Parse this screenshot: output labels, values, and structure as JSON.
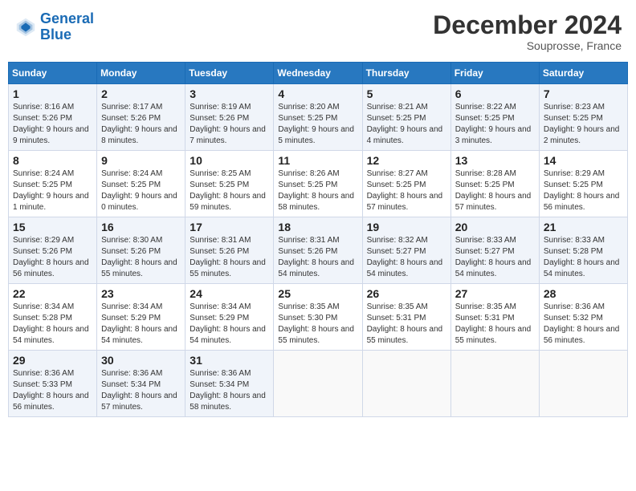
{
  "header": {
    "logo_line1": "General",
    "logo_line2": "Blue",
    "month": "December 2024",
    "location": "Souprosse, France"
  },
  "weekdays": [
    "Sunday",
    "Monday",
    "Tuesday",
    "Wednesday",
    "Thursday",
    "Friday",
    "Saturday"
  ],
  "weeks": [
    [
      {
        "day": "1",
        "sunrise": "8:16 AM",
        "sunset": "5:26 PM",
        "daylight": "9 hours and 9 minutes."
      },
      {
        "day": "2",
        "sunrise": "8:17 AM",
        "sunset": "5:26 PM",
        "daylight": "9 hours and 8 minutes."
      },
      {
        "day": "3",
        "sunrise": "8:19 AM",
        "sunset": "5:26 PM",
        "daylight": "9 hours and 7 minutes."
      },
      {
        "day": "4",
        "sunrise": "8:20 AM",
        "sunset": "5:25 PM",
        "daylight": "9 hours and 5 minutes."
      },
      {
        "day": "5",
        "sunrise": "8:21 AM",
        "sunset": "5:25 PM",
        "daylight": "9 hours and 4 minutes."
      },
      {
        "day": "6",
        "sunrise": "8:22 AM",
        "sunset": "5:25 PM",
        "daylight": "9 hours and 3 minutes."
      },
      {
        "day": "7",
        "sunrise": "8:23 AM",
        "sunset": "5:25 PM",
        "daylight": "9 hours and 2 minutes."
      }
    ],
    [
      {
        "day": "8",
        "sunrise": "8:24 AM",
        "sunset": "5:25 PM",
        "daylight": "9 hours and 1 minute."
      },
      {
        "day": "9",
        "sunrise": "8:24 AM",
        "sunset": "5:25 PM",
        "daylight": "9 hours and 0 minutes."
      },
      {
        "day": "10",
        "sunrise": "8:25 AM",
        "sunset": "5:25 PM",
        "daylight": "8 hours and 59 minutes."
      },
      {
        "day": "11",
        "sunrise": "8:26 AM",
        "sunset": "5:25 PM",
        "daylight": "8 hours and 58 minutes."
      },
      {
        "day": "12",
        "sunrise": "8:27 AM",
        "sunset": "5:25 PM",
        "daylight": "8 hours and 57 minutes."
      },
      {
        "day": "13",
        "sunrise": "8:28 AM",
        "sunset": "5:25 PM",
        "daylight": "8 hours and 57 minutes."
      },
      {
        "day": "14",
        "sunrise": "8:29 AM",
        "sunset": "5:25 PM",
        "daylight": "8 hours and 56 minutes."
      }
    ],
    [
      {
        "day": "15",
        "sunrise": "8:29 AM",
        "sunset": "5:26 PM",
        "daylight": "8 hours and 56 minutes."
      },
      {
        "day": "16",
        "sunrise": "8:30 AM",
        "sunset": "5:26 PM",
        "daylight": "8 hours and 55 minutes."
      },
      {
        "day": "17",
        "sunrise": "8:31 AM",
        "sunset": "5:26 PM",
        "daylight": "8 hours and 55 minutes."
      },
      {
        "day": "18",
        "sunrise": "8:31 AM",
        "sunset": "5:26 PM",
        "daylight": "8 hours and 54 minutes."
      },
      {
        "day": "19",
        "sunrise": "8:32 AM",
        "sunset": "5:27 PM",
        "daylight": "8 hours and 54 minutes."
      },
      {
        "day": "20",
        "sunrise": "8:33 AM",
        "sunset": "5:27 PM",
        "daylight": "8 hours and 54 minutes."
      },
      {
        "day": "21",
        "sunrise": "8:33 AM",
        "sunset": "5:28 PM",
        "daylight": "8 hours and 54 minutes."
      }
    ],
    [
      {
        "day": "22",
        "sunrise": "8:34 AM",
        "sunset": "5:28 PM",
        "daylight": "8 hours and 54 minutes."
      },
      {
        "day": "23",
        "sunrise": "8:34 AM",
        "sunset": "5:29 PM",
        "daylight": "8 hours and 54 minutes."
      },
      {
        "day": "24",
        "sunrise": "8:34 AM",
        "sunset": "5:29 PM",
        "daylight": "8 hours and 54 minutes."
      },
      {
        "day": "25",
        "sunrise": "8:35 AM",
        "sunset": "5:30 PM",
        "daylight": "8 hours and 55 minutes."
      },
      {
        "day": "26",
        "sunrise": "8:35 AM",
        "sunset": "5:31 PM",
        "daylight": "8 hours and 55 minutes."
      },
      {
        "day": "27",
        "sunrise": "8:35 AM",
        "sunset": "5:31 PM",
        "daylight": "8 hours and 55 minutes."
      },
      {
        "day": "28",
        "sunrise": "8:36 AM",
        "sunset": "5:32 PM",
        "daylight": "8 hours and 56 minutes."
      }
    ],
    [
      {
        "day": "29",
        "sunrise": "8:36 AM",
        "sunset": "5:33 PM",
        "daylight": "8 hours and 56 minutes."
      },
      {
        "day": "30",
        "sunrise": "8:36 AM",
        "sunset": "5:34 PM",
        "daylight": "8 hours and 57 minutes."
      },
      {
        "day": "31",
        "sunrise": "8:36 AM",
        "sunset": "5:34 PM",
        "daylight": "8 hours and 58 minutes."
      },
      null,
      null,
      null,
      null
    ]
  ]
}
